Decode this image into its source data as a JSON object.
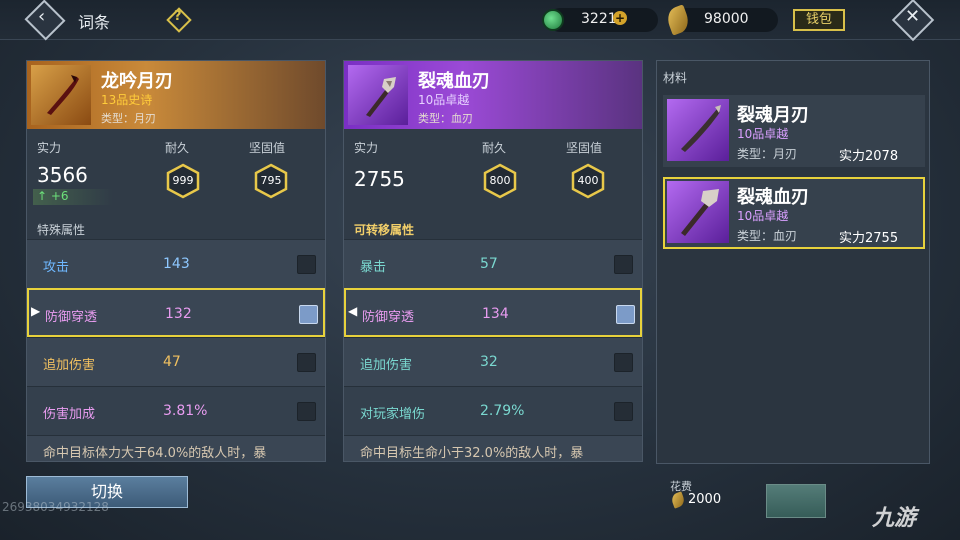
{
  "header": {
    "title": "词条",
    "back_icon": "back-arrow-icon",
    "help_icon": "question-diamond-icon",
    "currency": [
      {
        "icon": "jade-coin-icon",
        "value": "32210"
      },
      {
        "icon": "gold-leaf-icon",
        "value": "98000"
      }
    ],
    "bag_label": "钱包",
    "close_icon": "close-x-icon"
  },
  "left_item": {
    "name": "龙吟月刃",
    "grade": "13品史诗",
    "type": "类型：月刃",
    "power_label": "实力",
    "power": "3566",
    "power_delta": "+6",
    "durability_label": "耐久",
    "durability": "999",
    "solidity_label": "坚固值",
    "solidity": "795",
    "section_title": "特殊属性",
    "rows": [
      {
        "name": "攻击",
        "value": "143",
        "name_color": "#6fb8ff",
        "value_color": "#8ec8ff",
        "selected": false
      },
      {
        "name": "防御穿透",
        "value": "132",
        "name_color": "#e89cf0",
        "value_color": "#e89cf0",
        "selected": true
      },
      {
        "name": "追加伤害",
        "value": "47",
        "name_color": "#f0c060",
        "value_color": "#f0c060",
        "selected": false
      },
      {
        "name": "伤害加成",
        "value": "3.81%",
        "name_color": "#e89cf0",
        "value_color": "#e89cf0",
        "selected": false
      }
    ],
    "cut_text": "命中目标体力大于64.0%的敌人时，暴"
  },
  "right_item": {
    "name": "裂魂血刃",
    "grade": "10品卓越",
    "type": "类型：血刃",
    "power_label": "实力",
    "power": "2755",
    "durability_label": "耐久",
    "durability": "800",
    "solidity_label": "坚固值",
    "solidity": "400",
    "section_title": "可转移属性",
    "rows": [
      {
        "name": "暴击",
        "value": "57",
        "name_color": "#7ad8d0",
        "value_color": "#7ad8d0",
        "selected": false
      },
      {
        "name": "防御穿透",
        "value": "134",
        "name_color": "#e89cf0",
        "value_color": "#e89cf0",
        "selected": true
      },
      {
        "name": "追加伤害",
        "value": "32",
        "name_color": "#7ad8d0",
        "value_color": "#7ad8d0",
        "selected": false
      },
      {
        "name": "对玩家增伤",
        "value": "2.79%",
        "name_color": "#7ad8d0",
        "value_color": "#7ad8d0",
        "selected": false
      }
    ],
    "cut_text": "命中目标生命小于32.0%的敌人时，暴"
  },
  "materials": {
    "title": "材料",
    "items": [
      {
        "name": "裂魂月刃",
        "grade": "10品卓越",
        "type": "类型：月刃",
        "power": "实力2078",
        "selected": false
      },
      {
        "name": "裂魂血刃",
        "grade": "10品卓越",
        "type": "类型：血刃",
        "power": "实力2755",
        "selected": true
      }
    ]
  },
  "footer": {
    "switch_label": "切换",
    "uid": "26938034932128",
    "cost_label": "花费",
    "cost_value": "2000",
    "logo": "九游"
  }
}
